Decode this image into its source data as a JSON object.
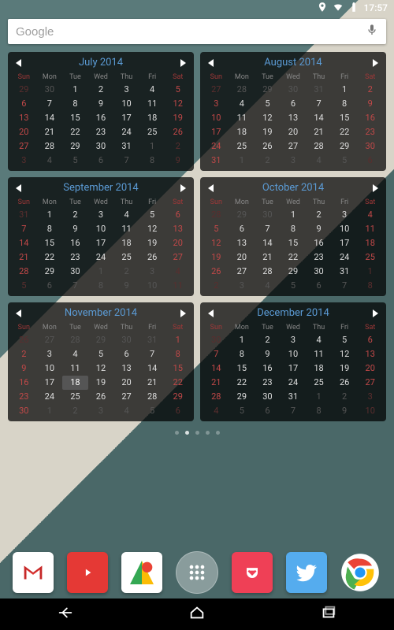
{
  "status": {
    "time": "17:57"
  },
  "search": {
    "brand": "Google",
    "placeholder": ""
  },
  "dow": [
    "Sun",
    "Mon",
    "Tue",
    "Wed",
    "Thu",
    "Fri",
    "Sat"
  ],
  "weekend_indices": [
    0,
    6
  ],
  "months": [
    {
      "title": "July 2014",
      "today": null,
      "weeks": [
        [
          {
            "n": 29,
            "dim": true
          },
          {
            "n": 30,
            "dim": true
          },
          {
            "n": 1
          },
          {
            "n": 2
          },
          {
            "n": 3
          },
          {
            "n": 4
          },
          {
            "n": 5
          }
        ],
        [
          {
            "n": 6
          },
          {
            "n": 7
          },
          {
            "n": 8
          },
          {
            "n": 9
          },
          {
            "n": 10
          },
          {
            "n": 11
          },
          {
            "n": 12
          }
        ],
        [
          {
            "n": 13
          },
          {
            "n": 14
          },
          {
            "n": 15
          },
          {
            "n": 16
          },
          {
            "n": 17
          },
          {
            "n": 18
          },
          {
            "n": 19
          }
        ],
        [
          {
            "n": 20
          },
          {
            "n": 21
          },
          {
            "n": 22
          },
          {
            "n": 23
          },
          {
            "n": 24
          },
          {
            "n": 25
          },
          {
            "n": 26
          }
        ],
        [
          {
            "n": 27
          },
          {
            "n": 28
          },
          {
            "n": 29
          },
          {
            "n": 30
          },
          {
            "n": 31
          },
          {
            "n": 1,
            "dim": true
          },
          {
            "n": 2,
            "dim": true
          }
        ],
        [
          {
            "n": 3,
            "dim": true
          },
          {
            "n": 4,
            "dim": true
          },
          {
            "n": 5,
            "dim": true
          },
          {
            "n": 6,
            "dim": true
          },
          {
            "n": 7,
            "dim": true
          },
          {
            "n": 8,
            "dim": true
          },
          {
            "n": 9,
            "dim": true
          }
        ]
      ]
    },
    {
      "title": "August 2014",
      "today": null,
      "weeks": [
        [
          {
            "n": 27,
            "dim": true
          },
          {
            "n": 28,
            "dim": true
          },
          {
            "n": 29,
            "dim": true
          },
          {
            "n": 30,
            "dim": true
          },
          {
            "n": 31,
            "dim": true
          },
          {
            "n": 1
          },
          {
            "n": 2
          }
        ],
        [
          {
            "n": 3
          },
          {
            "n": 4
          },
          {
            "n": 5
          },
          {
            "n": 6
          },
          {
            "n": 7
          },
          {
            "n": 8
          },
          {
            "n": 9
          }
        ],
        [
          {
            "n": 10
          },
          {
            "n": 11
          },
          {
            "n": 12
          },
          {
            "n": 13
          },
          {
            "n": 14
          },
          {
            "n": 15
          },
          {
            "n": 16
          }
        ],
        [
          {
            "n": 17
          },
          {
            "n": 18
          },
          {
            "n": 19
          },
          {
            "n": 20
          },
          {
            "n": 21
          },
          {
            "n": 22
          },
          {
            "n": 23
          }
        ],
        [
          {
            "n": 24
          },
          {
            "n": 25
          },
          {
            "n": 26
          },
          {
            "n": 27
          },
          {
            "n": 28
          },
          {
            "n": 29
          },
          {
            "n": 30
          }
        ],
        [
          {
            "n": 31
          },
          {
            "n": 1,
            "dim": true
          },
          {
            "n": 2,
            "dim": true
          },
          {
            "n": 3,
            "dim": true
          },
          {
            "n": 4,
            "dim": true
          },
          {
            "n": 5,
            "dim": true
          },
          {
            "n": 6,
            "dim": true
          }
        ]
      ]
    },
    {
      "title": "September 2014",
      "today": null,
      "weeks": [
        [
          {
            "n": 31,
            "dim": true
          },
          {
            "n": 1
          },
          {
            "n": 2
          },
          {
            "n": 3
          },
          {
            "n": 4
          },
          {
            "n": 5
          },
          {
            "n": 6
          }
        ],
        [
          {
            "n": 7
          },
          {
            "n": 8
          },
          {
            "n": 9
          },
          {
            "n": 10
          },
          {
            "n": 11
          },
          {
            "n": 12
          },
          {
            "n": 13
          }
        ],
        [
          {
            "n": 14
          },
          {
            "n": 15
          },
          {
            "n": 16
          },
          {
            "n": 17
          },
          {
            "n": 18
          },
          {
            "n": 19
          },
          {
            "n": 20
          }
        ],
        [
          {
            "n": 21
          },
          {
            "n": 22
          },
          {
            "n": 23
          },
          {
            "n": 24
          },
          {
            "n": 25
          },
          {
            "n": 26
          },
          {
            "n": 27
          }
        ],
        [
          {
            "n": 28
          },
          {
            "n": 29
          },
          {
            "n": 30
          },
          {
            "n": 1,
            "dim": true
          },
          {
            "n": 2,
            "dim": true
          },
          {
            "n": 3,
            "dim": true
          },
          {
            "n": 4,
            "dim": true
          }
        ],
        [
          {
            "n": 5,
            "dim": true
          },
          {
            "n": 6,
            "dim": true
          },
          {
            "n": 7,
            "dim": true
          },
          {
            "n": 8,
            "dim": true
          },
          {
            "n": 9,
            "dim": true
          },
          {
            "n": 10,
            "dim": true
          },
          {
            "n": 11,
            "dim": true
          }
        ]
      ]
    },
    {
      "title": "October 2014",
      "today": null,
      "weeks": [
        [
          {
            "n": 28,
            "dim": true
          },
          {
            "n": 29,
            "dim": true
          },
          {
            "n": 30,
            "dim": true
          },
          {
            "n": 1
          },
          {
            "n": 2
          },
          {
            "n": 3
          },
          {
            "n": 4
          }
        ],
        [
          {
            "n": 5
          },
          {
            "n": 6
          },
          {
            "n": 7
          },
          {
            "n": 8
          },
          {
            "n": 9
          },
          {
            "n": 10
          },
          {
            "n": 11
          }
        ],
        [
          {
            "n": 12
          },
          {
            "n": 13
          },
          {
            "n": 14
          },
          {
            "n": 15
          },
          {
            "n": 16
          },
          {
            "n": 17
          },
          {
            "n": 18
          }
        ],
        [
          {
            "n": 19
          },
          {
            "n": 20
          },
          {
            "n": 21
          },
          {
            "n": 22
          },
          {
            "n": 23
          },
          {
            "n": 24
          },
          {
            "n": 25
          }
        ],
        [
          {
            "n": 26
          },
          {
            "n": 27
          },
          {
            "n": 28
          },
          {
            "n": 29
          },
          {
            "n": 30
          },
          {
            "n": 31
          },
          {
            "n": 1,
            "dim": true
          }
        ],
        [
          {
            "n": 2,
            "dim": true
          },
          {
            "n": 3,
            "dim": true
          },
          {
            "n": 4,
            "dim": true
          },
          {
            "n": 5,
            "dim": true
          },
          {
            "n": 6,
            "dim": true
          },
          {
            "n": 7,
            "dim": true
          },
          {
            "n": 8,
            "dim": true
          }
        ]
      ]
    },
    {
      "title": "November 2014",
      "today": 18,
      "weeks": [
        [
          {
            "n": 26,
            "dim": true
          },
          {
            "n": 27,
            "dim": true
          },
          {
            "n": 28,
            "dim": true
          },
          {
            "n": 29,
            "dim": true
          },
          {
            "n": 30,
            "dim": true
          },
          {
            "n": 31,
            "dim": true
          },
          {
            "n": 1
          }
        ],
        [
          {
            "n": 2
          },
          {
            "n": 3
          },
          {
            "n": 4
          },
          {
            "n": 5
          },
          {
            "n": 6
          },
          {
            "n": 7
          },
          {
            "n": 8
          }
        ],
        [
          {
            "n": 9
          },
          {
            "n": 10
          },
          {
            "n": 11
          },
          {
            "n": 12
          },
          {
            "n": 13
          },
          {
            "n": 14
          },
          {
            "n": 15
          }
        ],
        [
          {
            "n": 16
          },
          {
            "n": 17
          },
          {
            "n": 18
          },
          {
            "n": 19
          },
          {
            "n": 20
          },
          {
            "n": 21
          },
          {
            "n": 22
          }
        ],
        [
          {
            "n": 23
          },
          {
            "n": 24
          },
          {
            "n": 25
          },
          {
            "n": 26
          },
          {
            "n": 27
          },
          {
            "n": 28
          },
          {
            "n": 29
          }
        ],
        [
          {
            "n": 30
          },
          {
            "n": 1,
            "dim": true
          },
          {
            "n": 2,
            "dim": true
          },
          {
            "n": 3,
            "dim": true
          },
          {
            "n": 4,
            "dim": true
          },
          {
            "n": 5,
            "dim": true
          },
          {
            "n": 6,
            "dim": true
          }
        ]
      ]
    },
    {
      "title": "December 2014",
      "today": null,
      "weeks": [
        [
          {
            "n": 30,
            "dim": true
          },
          {
            "n": 1
          },
          {
            "n": 2
          },
          {
            "n": 3
          },
          {
            "n": 4
          },
          {
            "n": 5
          },
          {
            "n": 6
          }
        ],
        [
          {
            "n": 7
          },
          {
            "n": 8
          },
          {
            "n": 9
          },
          {
            "n": 10
          },
          {
            "n": 11
          },
          {
            "n": 12
          },
          {
            "n": 13
          }
        ],
        [
          {
            "n": 14
          },
          {
            "n": 15
          },
          {
            "n": 16
          },
          {
            "n": 17
          },
          {
            "n": 18
          },
          {
            "n": 19
          },
          {
            "n": 20
          }
        ],
        [
          {
            "n": 21
          },
          {
            "n": 22
          },
          {
            "n": 23
          },
          {
            "n": 24
          },
          {
            "n": 25
          },
          {
            "n": 26
          },
          {
            "n": 27
          }
        ],
        [
          {
            "n": 28
          },
          {
            "n": 29
          },
          {
            "n": 30
          },
          {
            "n": 31
          },
          {
            "n": 1,
            "dim": true
          },
          {
            "n": 2,
            "dim": true
          },
          {
            "n": 3,
            "dim": true
          }
        ],
        [
          {
            "n": 4,
            "dim": true
          },
          {
            "n": 5,
            "dim": true
          },
          {
            "n": 6,
            "dim": true
          },
          {
            "n": 7,
            "dim": true
          },
          {
            "n": 8,
            "dim": true
          },
          {
            "n": 9,
            "dim": true
          },
          {
            "n": 10,
            "dim": true
          }
        ]
      ]
    }
  ],
  "dock": {
    "apps": [
      "gmail",
      "youtube",
      "maps",
      "drawer",
      "pocket",
      "twitter",
      "chrome"
    ]
  },
  "pages": {
    "count": 5,
    "active": 1
  }
}
